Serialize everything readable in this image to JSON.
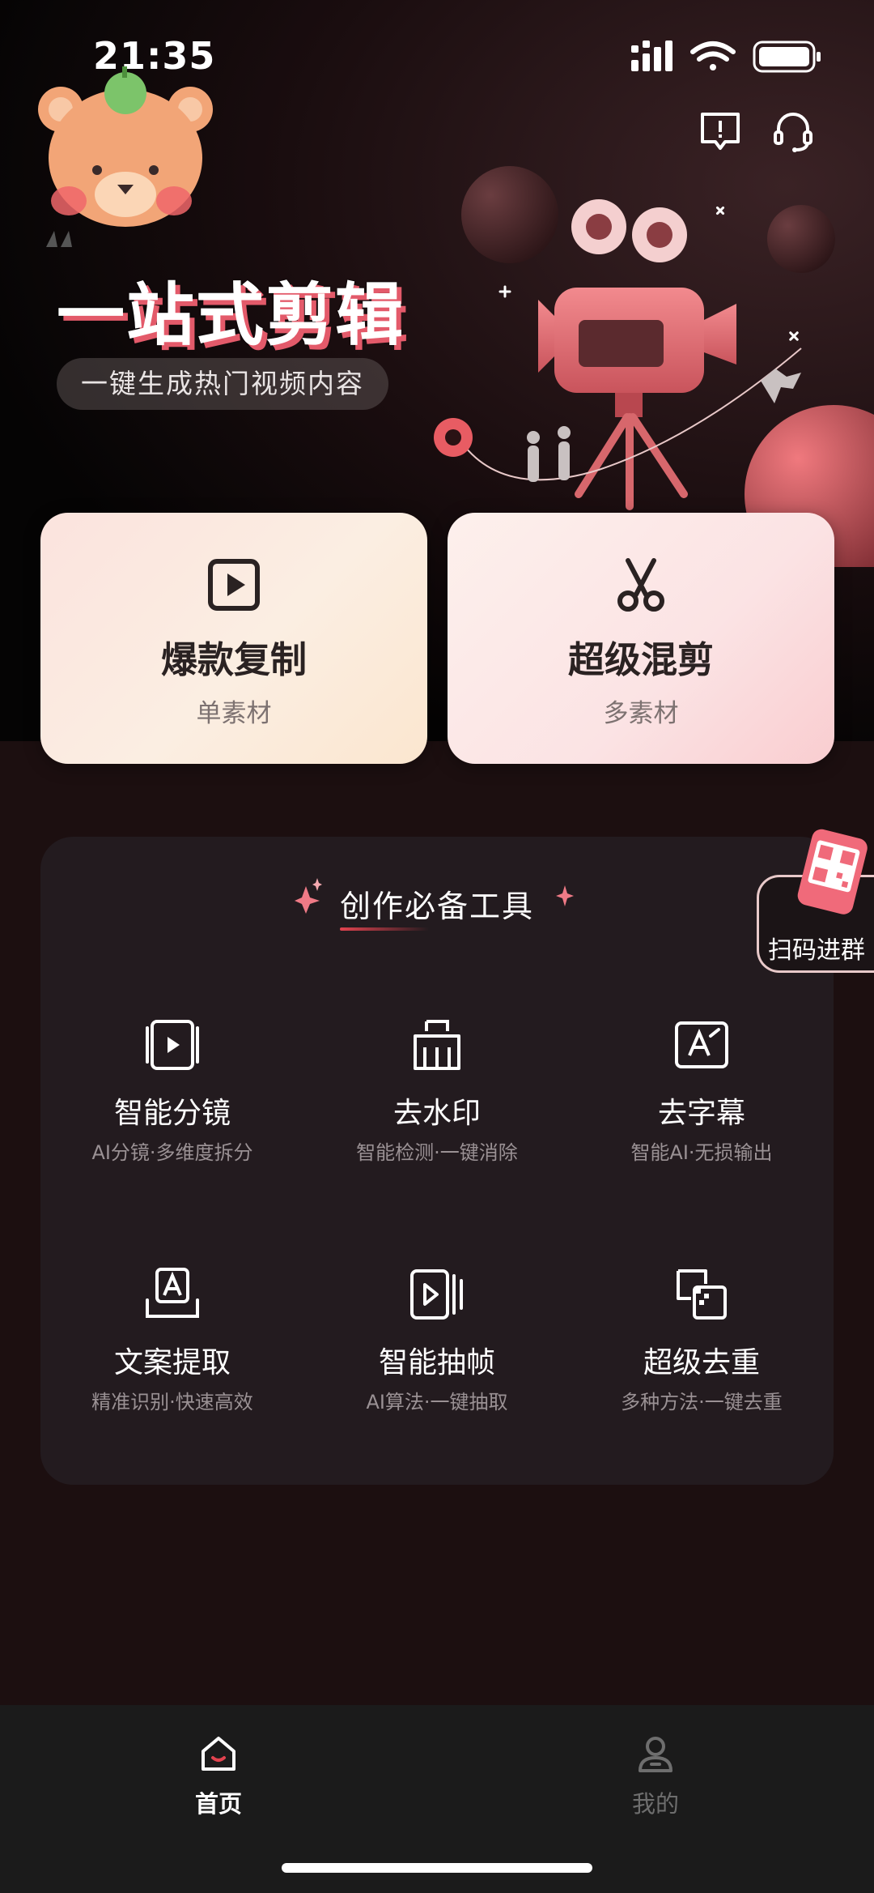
{
  "status_bar": {
    "time": "21:35"
  },
  "header_icons": {
    "feedback": "feedback-icon",
    "service": "headset-icon"
  },
  "hero": {
    "title": "一站式剪辑",
    "subtitle": "一键生成热门视频内容"
  },
  "feature_cards": [
    {
      "title": "爆款复制",
      "subtitle": "单素材",
      "icon": "play-square-icon"
    },
    {
      "title": "超级混剪",
      "subtitle": "多素材",
      "icon": "scissors-icon"
    }
  ],
  "tools": {
    "title": "创作必备工具",
    "items": [
      {
        "name": "智能分镜",
        "desc": "AI分镜·多维度拆分",
        "icon": "storyboard-icon"
      },
      {
        "name": "去水印",
        "desc": "智能检测·一键消除",
        "icon": "watermark-remove-icon"
      },
      {
        "name": "去字幕",
        "desc": "智能AI·无损输出",
        "icon": "subtitle-remove-icon"
      },
      {
        "name": "文案提取",
        "desc": "精准识别·快速高效",
        "icon": "text-extract-icon"
      },
      {
        "name": "智能抽帧",
        "desc": "AI算法·一键抽取",
        "icon": "frame-extract-icon"
      },
      {
        "name": "超级去重",
        "desc": "多种方法·一键去重",
        "icon": "dedupe-icon"
      }
    ]
  },
  "qr_group": {
    "label": "扫码进群"
  },
  "tab_bar": {
    "items": [
      {
        "label": "首页",
        "active": true
      },
      {
        "label": "我的",
        "active": false
      }
    ]
  },
  "colors": {
    "accent": "#e2434f",
    "card_text": "#2a2222",
    "tab_inactive": "#6e6e6e"
  }
}
